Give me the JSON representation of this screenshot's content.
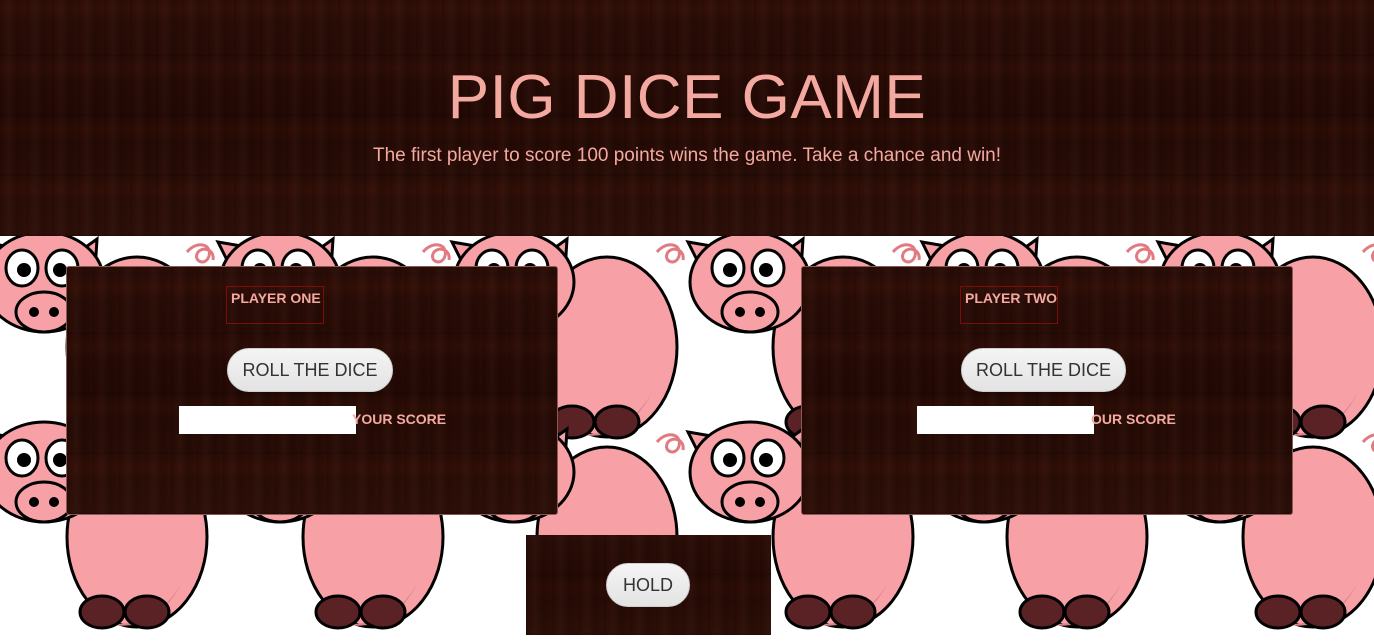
{
  "header": {
    "title": "PIG DICE GAME",
    "subtitle": "The first player to score 100 points wins the game. Take a chance and win!"
  },
  "player_one": {
    "name": "PLAYER ONE",
    "roll_label": "ROLL THE DICE",
    "score_value": "",
    "score_label": "YOUR SCORE"
  },
  "player_two": {
    "name": "PLAYER TWO",
    "roll_label": "ROLL THE DICE",
    "score_value": "",
    "score_label": "OUR SCORE"
  },
  "hold": {
    "label": "HOLD"
  },
  "colors": {
    "accent_text": "#f4a9a0",
    "panel_wood": "#2a0c06",
    "pig_pink": "#f7a1a6"
  },
  "background_pattern_icon": "pig-icon"
}
